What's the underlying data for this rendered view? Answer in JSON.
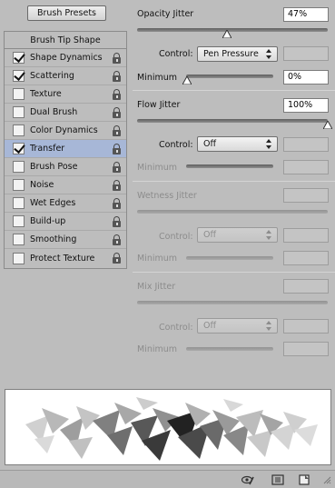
{
  "left": {
    "presets_button": "Brush Presets",
    "tip_shape_header": "Brush Tip Shape",
    "items": [
      {
        "label": "Shape Dynamics",
        "checked": true,
        "selected": false
      },
      {
        "label": "Scattering",
        "checked": true,
        "selected": false
      },
      {
        "label": "Texture",
        "checked": false,
        "selected": false
      },
      {
        "label": "Dual Brush",
        "checked": false,
        "selected": false
      },
      {
        "label": "Color Dynamics",
        "checked": false,
        "selected": false
      },
      {
        "label": "Transfer",
        "checked": true,
        "selected": true
      },
      {
        "label": "Brush Pose",
        "checked": false,
        "selected": false
      },
      {
        "label": "Noise",
        "checked": false,
        "selected": false
      },
      {
        "label": "Wet Edges",
        "checked": false,
        "selected": false
      },
      {
        "label": "Build-up",
        "checked": false,
        "selected": false
      },
      {
        "label": "Smoothing",
        "checked": false,
        "selected": false
      },
      {
        "label": "Protect Texture",
        "checked": false,
        "selected": false
      }
    ]
  },
  "transfer": {
    "opacity": {
      "label": "Opacity Jitter",
      "value": "47%",
      "control_label": "Control:",
      "control_value": "Pen Pressure",
      "minimum_label": "Minimum",
      "minimum_value": "0%"
    },
    "flow": {
      "label": "Flow Jitter",
      "value": "100%",
      "control_label": "Control:",
      "control_value": "Off",
      "minimum_label": "Minimum"
    },
    "wetness": {
      "label": "Wetness Jitter",
      "control_label": "Control:",
      "control_value": "Off",
      "minimum_label": "Minimum"
    },
    "mix": {
      "label": "Mix Jitter",
      "control_label": "Control:",
      "control_value": "Off",
      "minimum_label": "Minimum"
    }
  },
  "icons": {
    "toggle_preview": "eye-brush-icon",
    "create_preset": "grid-icon",
    "new_preset": "new-page-icon"
  },
  "colors": {
    "panel_bg": "#bdbdbd",
    "selected_row": "#a7b7d7",
    "field_bg": "#ffffff"
  }
}
